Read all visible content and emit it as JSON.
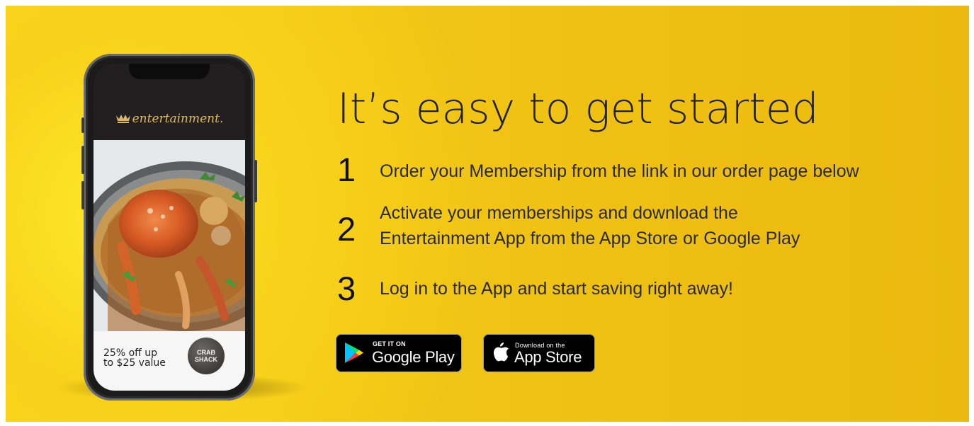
{
  "phone": {
    "brand": "entertainment.",
    "offer_line1": "25% off up",
    "offer_line2": "to $25 value",
    "badge_line1": "CRAB",
    "badge_line2": "SHACK"
  },
  "headline": "It’s easy to get started",
  "steps": [
    {
      "number": "1",
      "text": "Order your Membership from the link in our order page below"
    },
    {
      "number": "2",
      "line1": "Activate your memberships and download the",
      "line2": "Entertainment App from the App Store or Google Play"
    },
    {
      "number": "3",
      "text": "Log in to the App and start saving right away!"
    }
  ],
  "stores": {
    "google": {
      "small": "GET IT ON",
      "big": "Google Play"
    },
    "apple": {
      "small": "Download on the",
      "big": "App Store"
    }
  },
  "colors": {
    "banner": "#f1c515",
    "text": "#222222",
    "button": "#000000"
  },
  "icons": {
    "google": "google-play-icon",
    "apple": "apple-icon",
    "brand": "crown-icon"
  }
}
